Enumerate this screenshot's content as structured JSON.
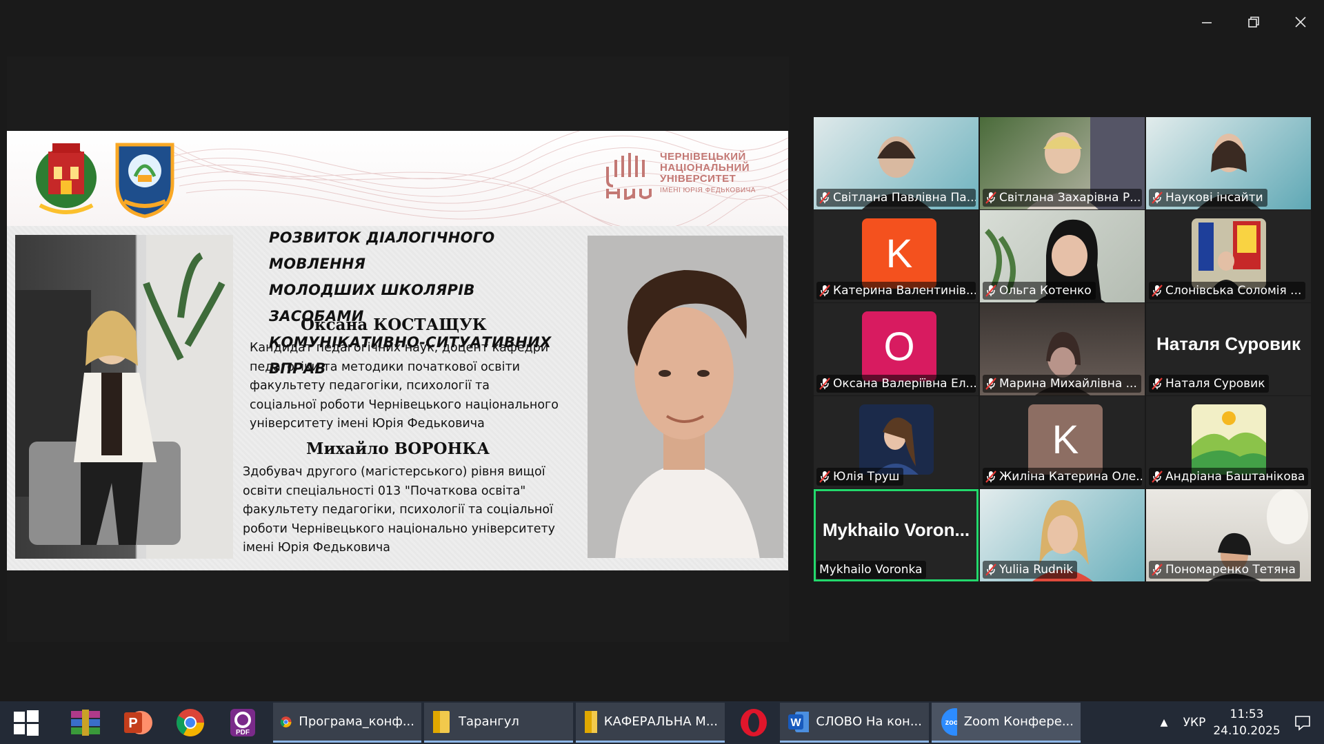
{
  "window": {
    "minimize_glyph": "—",
    "restore_glyph": "❐",
    "close_glyph": "✕"
  },
  "slide": {
    "title_lines": [
      "РОЗВИТОК ДІАЛОГІЧНОГО МОВЛЕННЯ",
      "МОЛОДШИХ ШКОЛЯРІВ ЗАСОБАМИ",
      "КОМУНІКАТИВНО-СИТУАТИВНИХ ВПРАВ"
    ],
    "university_lines": [
      "ЧЕРНІВЕЦЬКИЙ",
      "НАЦІОНАЛЬНИЙ",
      "УНІВЕРСИТЕТ"
    ],
    "university_sub": "ІМЕНІ ЮРІЯ ФЕДЬКОВИЧА",
    "person1": {
      "name": "Оксана КОСТАЩУК",
      "desc_lines": [
        "Кандидат педагогічних наук, доцент кафедри",
        "педагогіки та методики початкової освіти",
        "факультету педагогіки, психології та",
        "соціальної роботи Чернівецького національного",
        "університету імені Юрія Федьковича"
      ]
    },
    "person2": {
      "name": "Михайло ВОРОНКА",
      "desc_lines": [
        "Здобувач другого (магістерського) рівня  вищої",
        "освіти спеціальності 013 \"Початкова освіта\"",
        "факультету педагогіки, психології та соціальної",
        "роботи Чернівецького національно університету",
        "імені Юрія Федьковича"
      ]
    }
  },
  "gallery": {
    "participants": [
      {
        "label": "Світлана Павлівна Па...",
        "muted": true
      },
      {
        "label": "Світлана Захарівна Р...",
        "muted": true
      },
      {
        "label": "Наукові інсайти",
        "muted": true
      },
      {
        "label": "Катерина Валентинів...",
        "muted": true,
        "avatar_letter": "K",
        "avatar_color": "#f4511e"
      },
      {
        "label": "Ольга Котенко",
        "muted": true
      },
      {
        "label": "Слонівська Соломія ...",
        "muted": true
      },
      {
        "label": "Оксана Валеріївна Ел...",
        "muted": true,
        "avatar_letter": "O",
        "avatar_color": "#d81b60"
      },
      {
        "label": "Марина Михайлівна ...",
        "muted": true
      },
      {
        "label": "Наталя Суровик",
        "muted": true,
        "big_name": "Наталя Суровик"
      },
      {
        "label": "Юлія Труш",
        "muted": true
      },
      {
        "label": "Жиліна Катерина Оле...",
        "muted": true,
        "avatar_letter": "K",
        "avatar_color": "#8d6e63"
      },
      {
        "label": "Андріана Баштанікова",
        "muted": true
      },
      {
        "label": "Mykhailo Voronka",
        "muted": false,
        "big_name": "Mykhailo  Voron...",
        "speaking": true
      },
      {
        "label": "Yuliia Rudnik",
        "muted": true
      },
      {
        "label": "Пономаренко Тетяна",
        "muted": true
      }
    ]
  },
  "taskbar": {
    "apps": [
      {
        "label": "Програма_конф..."
      },
      {
        "label": "Тарангул"
      },
      {
        "label": "КАФЕРАЛЬНА М..."
      },
      {
        "label": "СЛОВО На кон..."
      },
      {
        "label": "Zoom Конфере..."
      }
    ],
    "pdf_label": "PDF",
    "zoom_badge": "zoom",
    "word_letter": "W",
    "ppt_letter": "P",
    "language": "УКР",
    "time": "11:53",
    "date": "24.10.2025"
  }
}
